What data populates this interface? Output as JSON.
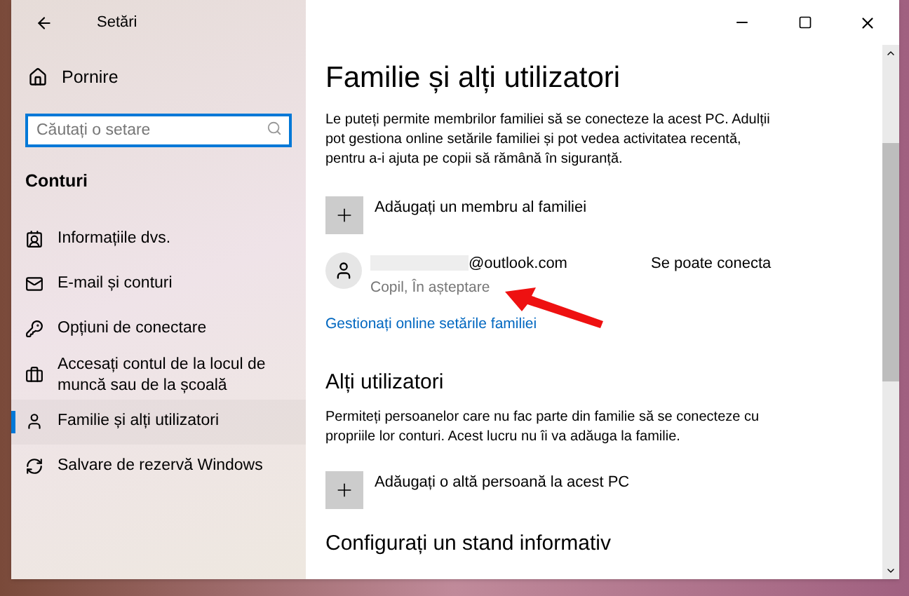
{
  "window": {
    "title": "Setări"
  },
  "sidebar": {
    "home": "Pornire",
    "search": {
      "placeholder": "Căutați o setare"
    },
    "section": "Conturi",
    "items": [
      {
        "kind": "info",
        "label": "Informațiile dvs.",
        "selected": false
      },
      {
        "kind": "mail",
        "label": "E-mail și conturi",
        "selected": false
      },
      {
        "kind": "key",
        "label": "Opțiuni de conectare",
        "selected": false
      },
      {
        "kind": "work",
        "label": "Accesați contul de la locul de muncă sau de la școală",
        "selected": false
      },
      {
        "kind": "family",
        "label": "Familie și alți utilizatori",
        "selected": true
      },
      {
        "kind": "sync",
        "label": "Salvare de rezervă Windows",
        "selected": false
      }
    ]
  },
  "content": {
    "title": "Familie și alți utilizatori",
    "intro": "Le puteți permite membrilor familiei să se conecteze la acest PC. Adulții pot gestiona online setările familiei și pot vedea activitatea recentă, pentru a-i ajuta pe copii să rămână în siguranță.",
    "add_family": "Adăugați un membru al familiei",
    "member": {
      "email": "@outlook.com",
      "status": "Copil, În așteptare",
      "access": "Se poate conecta"
    },
    "manage_link": "Gestionați online setările familiei",
    "others_title": "Alți utilizatori",
    "others_text": "Permiteți persoanelor care nu fac parte din familie să se conecteze cu propriile lor conturi. Acest lucru nu îi va adăuga la familie.",
    "add_other": "Adăugați o altă persoană la acest PC",
    "kiosk_title": "Configurați un stand informativ"
  }
}
